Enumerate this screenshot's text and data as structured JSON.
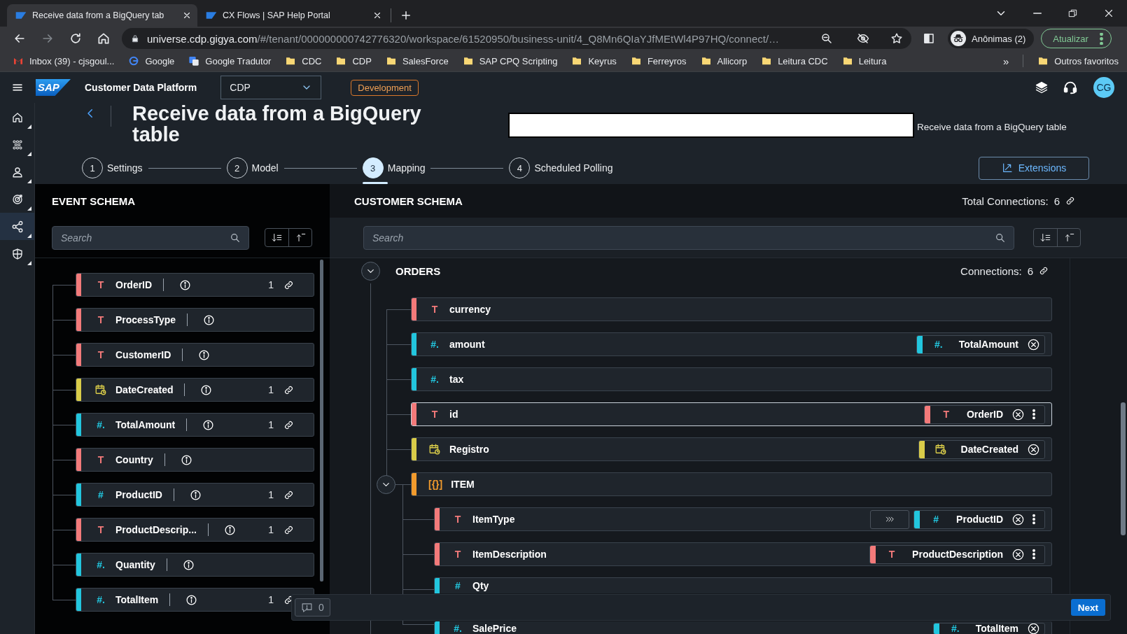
{
  "browser": {
    "tabs": [
      {
        "title": "Receive data from a BigQuery tab",
        "selected": true
      },
      {
        "title": "CX Flows | SAP Help Portal",
        "selected": false
      }
    ],
    "address": {
      "host": "universe.cdp.gigya.com",
      "path": "/#/tenant/000000000742776320/workspace/61520950/business-unit/4_Q8Mn6QIaYJfMEtWl4P97HQ/connect/…"
    },
    "profile": "Anônimas (2)",
    "update_button": "Atualizar",
    "bookmarks": [
      {
        "kind": "gmail",
        "label": "Inbox (39) - cjsgoul..."
      },
      {
        "kind": "google",
        "label": "Google"
      },
      {
        "kind": "translate",
        "label": "Google Tradutor"
      },
      {
        "kind": "folder",
        "label": "CDC"
      },
      {
        "kind": "folder",
        "label": "CDP"
      },
      {
        "kind": "folder",
        "label": "SalesForce"
      },
      {
        "kind": "folder",
        "label": "SAP CPQ Scripting"
      },
      {
        "kind": "folder",
        "label": "Keyrus"
      },
      {
        "kind": "folder",
        "label": "Ferreyros"
      },
      {
        "kind": "folder",
        "label": "Allicorp"
      },
      {
        "kind": "folder",
        "label": "Leitura CDC"
      },
      {
        "kind": "folder",
        "label": "Leitura"
      }
    ],
    "more_bookmarks": "»",
    "other_bookmarks": "Outros favoritos"
  },
  "app": {
    "logo": "SAP",
    "title": "Customer Data Platform",
    "workspace_select": "CDP",
    "environment_badge": "Development",
    "avatar": "CG"
  },
  "nav_rail": [
    {
      "kind": "home",
      "selected": false
    },
    {
      "kind": "cluster",
      "selected": false
    },
    {
      "kind": "person",
      "selected": false
    },
    {
      "kind": "target",
      "selected": false
    },
    {
      "kind": "share",
      "selected": true
    },
    {
      "kind": "shield",
      "selected": false
    }
  ],
  "page": {
    "title": "Receive data from a BigQuery table",
    "subtitle": "Receive data from a BigQuery table",
    "steps": [
      {
        "number": "1",
        "label": "Settings",
        "selected": false
      },
      {
        "number": "2",
        "label": "Model",
        "selected": false
      },
      {
        "number": "3",
        "label": "Mapping",
        "selected": true
      },
      {
        "number": "4",
        "label": "Scheduled Polling",
        "selected": false
      }
    ],
    "extensions_button": "Extensions"
  },
  "event_schema": {
    "title": "EVENT SCHEMA",
    "search_placeholder": "Search",
    "fields": [
      {
        "kind": "text",
        "glyph": "T",
        "name": "OrderID",
        "count": "1"
      },
      {
        "kind": "text",
        "glyph": "T",
        "name": "ProcessType"
      },
      {
        "kind": "text",
        "glyph": "T",
        "name": "CustomerID"
      },
      {
        "kind": "date",
        "name": "DateCreated",
        "count": "1"
      },
      {
        "kind": "number",
        "glyph": "#.",
        "name": "TotalAmount",
        "count": "1"
      },
      {
        "kind": "text",
        "glyph": "T",
        "name": "Country"
      },
      {
        "kind": "number",
        "glyph": "#",
        "name": "ProductID",
        "count": "1"
      },
      {
        "kind": "text",
        "glyph": "T",
        "name": "ProductDescrip...",
        "count": "1"
      },
      {
        "kind": "number",
        "glyph": "#.",
        "name": "Quantity"
      },
      {
        "kind": "number",
        "glyph": "#.",
        "name": "TotalItem",
        "count": "1"
      }
    ]
  },
  "customer_schema": {
    "title": "CUSTOMER SCHEMA",
    "total_connections_label": "Total Connections:",
    "total_connections": "6",
    "search_placeholder": "Search",
    "group": {
      "name": "ORDERS",
      "expanded": true,
      "connections_label": "Connections:",
      "connections": "6",
      "fields": [
        {
          "kind": "text",
          "glyph": "T",
          "name": "currency",
          "selected": false
        },
        {
          "kind": "number",
          "glyph": "#.",
          "name": "amount",
          "selected": false,
          "mapped": {
            "kind": "number",
            "glyph": "#.",
            "name": "TotalAmount",
            "menu": false,
            "transform": false
          }
        },
        {
          "kind": "number",
          "glyph": "#.",
          "name": "tax",
          "selected": false
        },
        {
          "kind": "text",
          "glyph": "T",
          "name": "id",
          "selected": true,
          "mapped": {
            "kind": "text",
            "glyph": "T",
            "name": "OrderID",
            "menu": true,
            "transform": false
          }
        },
        {
          "kind": "date",
          "name": "Registro",
          "selected": false,
          "mapped": {
            "kind": "date",
            "name": "DateCreated",
            "menu": false,
            "transform": false
          }
        },
        {
          "kind": "array",
          "glyph": "[{}]",
          "name": "ITEM",
          "selected": false,
          "expanded": true,
          "children": [
            {
              "kind": "text",
              "glyph": "T",
              "name": "ItemType",
              "selected": false,
              "mapped": {
                "kind": "number",
                "glyph": "#",
                "name": "ProductID",
                "menu": true,
                "transform": true
              }
            },
            {
              "kind": "text",
              "glyph": "T",
              "name": "ItemDescription",
              "selected": false,
              "mapped": {
                "kind": "text",
                "glyph": "T",
                "name": "ProductDescription",
                "menu": true,
                "transform": false
              }
            },
            {
              "kind": "number",
              "glyph": "#",
              "name": "Qty",
              "selected": false
            },
            {
              "kind": "number",
              "glyph": "#.",
              "name": "SalePrice",
              "selected": false,
              "mapped": {
                "kind": "number",
                "glyph": "#.",
                "name": "TotalItem",
                "menu": false,
                "transform": false
              }
            }
          ]
        }
      ]
    }
  },
  "footer": {
    "feedback_count": "0",
    "next_button": "Next"
  }
}
